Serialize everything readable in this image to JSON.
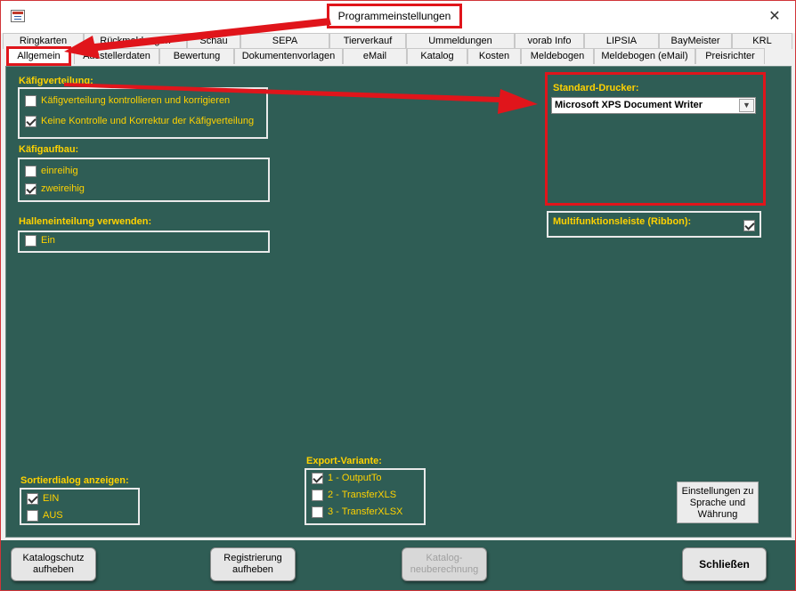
{
  "window": {
    "title": "Programmeinstellungen",
    "close_glyph": "✕",
    "icon": "access-form-icon"
  },
  "tabs": {
    "row1": [
      "Ringkarten",
      "Rückmeldungen",
      "Schau",
      "SEPA",
      "Tierverkauf",
      "Ummeldungen",
      "vorab Info",
      "LIPSIA",
      "BayMeister",
      "KRL"
    ],
    "row2": [
      "Ausstellerdaten",
      "Bewertung",
      "Dokumentenvorlagen",
      "eMail",
      "Katalog",
      "Kosten",
      "Meldebogen",
      "Meldebogen (eMail)",
      "Preisrichter"
    ],
    "active": "Allgemein"
  },
  "groups": {
    "kaefigverteilung": {
      "title": "Käfigverteilung:",
      "options": [
        {
          "label": "Käfigverteilung kontrollieren und korrigieren",
          "checked": false
        },
        {
          "label": "Keine Kontrolle und Korrektur der Käfigverteilung",
          "checked": true
        }
      ]
    },
    "kaefigaufbau": {
      "title": "Käfigaufbau:",
      "options": [
        {
          "label": "einreihig",
          "checked": false
        },
        {
          "label": "zweireihig",
          "checked": true
        }
      ]
    },
    "halleneinteilung": {
      "title": "Halleneinteilung verwenden:",
      "options": [
        {
          "label": "Ein",
          "checked": false
        }
      ]
    },
    "standard_drucker": {
      "title": "Standard-Drucker:",
      "value": "Microsoft XPS Document Writer"
    },
    "ribbon": {
      "title": "Multifunktionsleiste (Ribbon):",
      "checked": true
    },
    "sortierdialog": {
      "title": "Sortierdialog anzeigen:",
      "options": [
        {
          "label": "EIN",
          "checked": true
        },
        {
          "label": "AUS",
          "checked": false
        }
      ]
    },
    "export": {
      "title": "Export-Variante:",
      "options": [
        {
          "label": "1 - OutputTo",
          "checked": true
        },
        {
          "label": "2 - TransferXLS",
          "checked": false
        },
        {
          "label": "3 - TransferXLSX",
          "checked": false
        }
      ]
    }
  },
  "buttons": {
    "settings_line1": "Einstellungen zu",
    "settings_line2": "Sprache und",
    "settings_line3": "Währung",
    "katalogschutz_line1": "Katalogschutz",
    "katalogschutz_line2": "aufheben",
    "registrierung_line1": "Registrierung",
    "registrierung_line2": "aufheben",
    "katalog_neu_line1": "Katalog-",
    "katalog_neu_line2": "neuberechnung",
    "schliessen": "Schließen"
  },
  "colors": {
    "panel": "#2f5d55",
    "label": "#ffd200",
    "highlight": "#e0151b"
  }
}
